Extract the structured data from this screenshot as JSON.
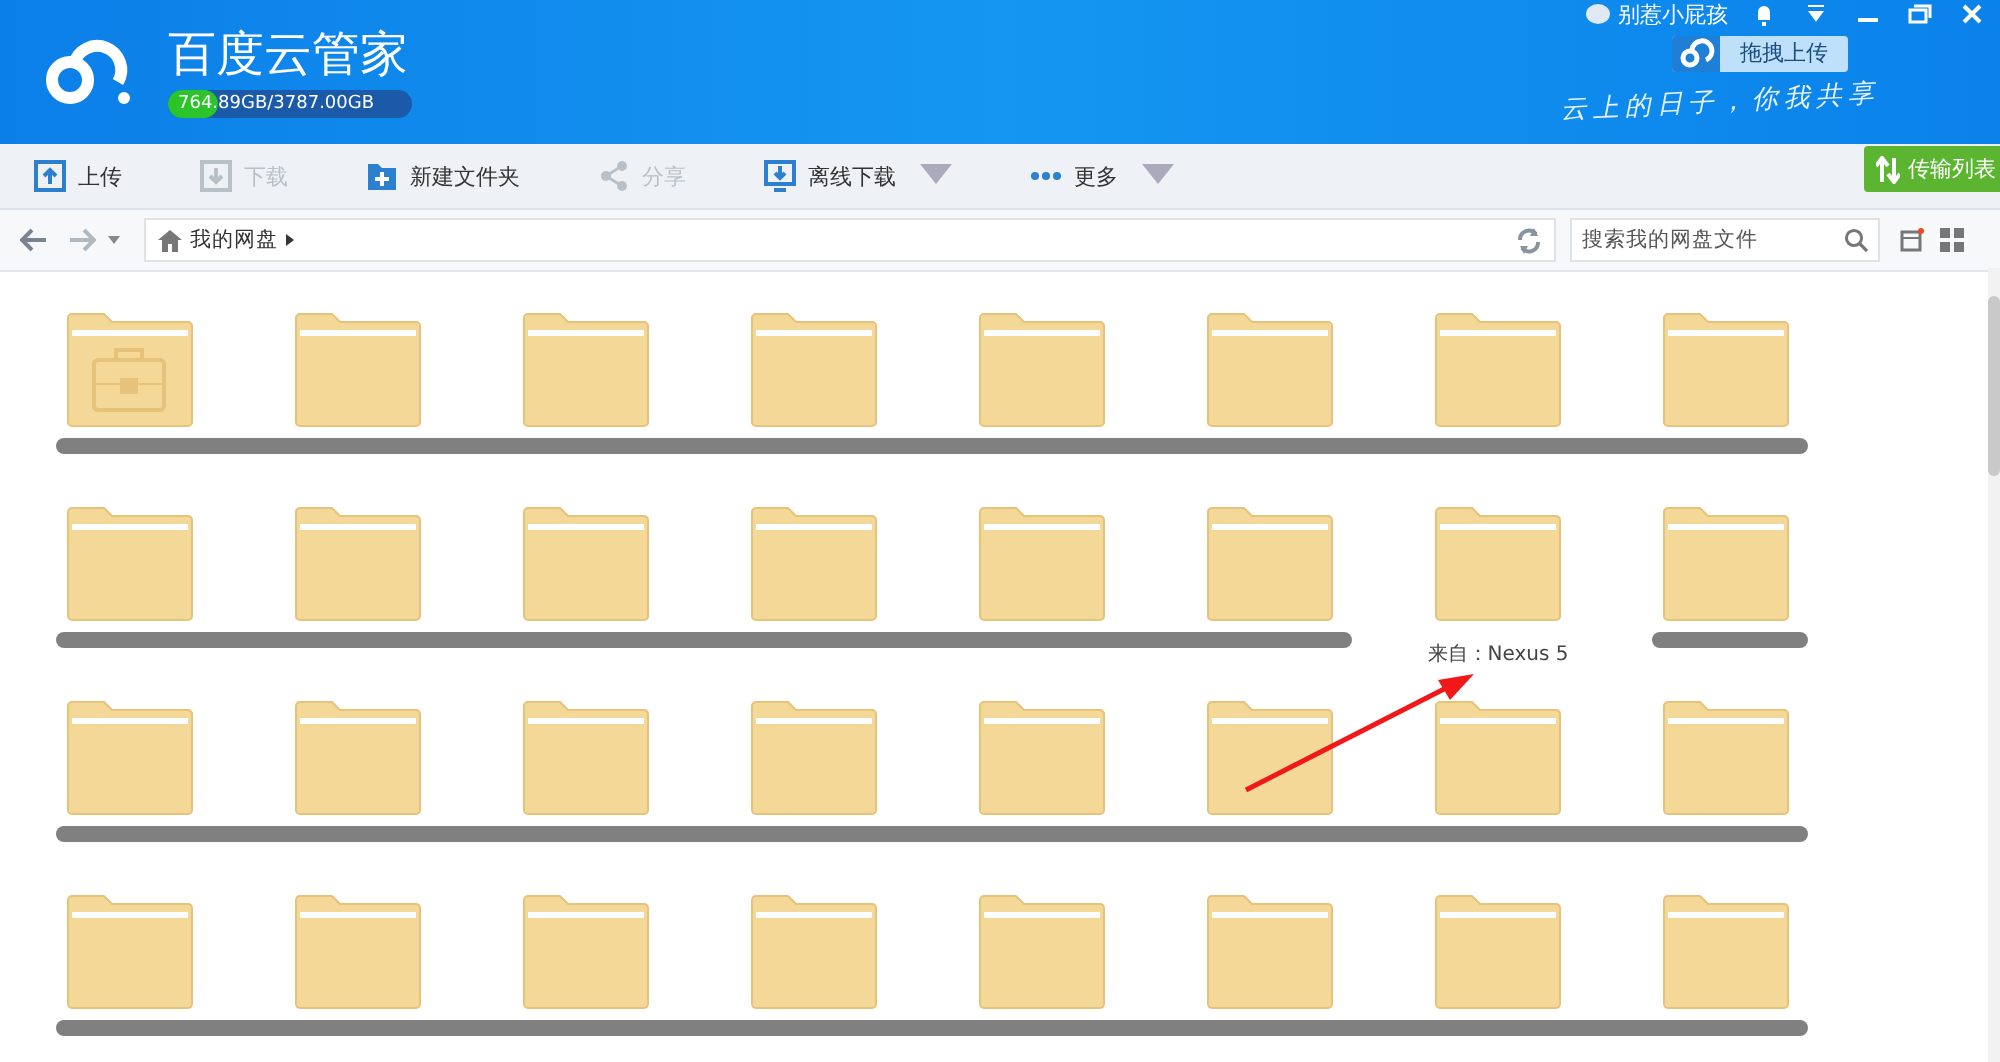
{
  "header": {
    "title": "百度云管家",
    "storage": {
      "text": "764.89GB/3787.00GB",
      "level": 0.202
    },
    "user": "别惹小屁孩",
    "drag_upload": "拖拽上传",
    "slogan": "云上的日子，你我共享"
  },
  "toolbar": [
    {
      "kind": "upload",
      "label": "上传",
      "disabled": false,
      "dropdown": false
    },
    {
      "kind": "download",
      "label": "下载",
      "disabled": true,
      "dropdown": false
    },
    {
      "kind": "newfolder",
      "label": "新建文件夹",
      "disabled": false,
      "dropdown": false
    },
    {
      "kind": "share",
      "label": "分享",
      "disabled": true,
      "dropdown": false
    },
    {
      "kind": "offline",
      "label": "离线下载",
      "disabled": false,
      "dropdown": true
    },
    {
      "kind": "more",
      "label": "更多",
      "disabled": false,
      "dropdown": true
    }
  ],
  "transfer_button": "传输列表",
  "breadcrumb": [
    "我的网盘"
  ],
  "search": {
    "placeholder": "搜索我的网盘文件"
  },
  "rows": [
    {
      "folders": [
        {
          "kind": "safe",
          "redacted": true
        },
        {
          "kind": "folder",
          "redacted": true
        },
        {
          "kind": "folder",
          "redacted": true
        },
        {
          "kind": "folder",
          "redacted": true
        },
        {
          "kind": "folder",
          "redacted": true
        },
        {
          "kind": "folder",
          "redacted": true
        },
        {
          "kind": "folder",
          "redacted": true
        },
        {
          "kind": "folder",
          "redacted": true
        }
      ]
    },
    {
      "folders": [
        {
          "kind": "folder",
          "redacted": true
        },
        {
          "kind": "folder",
          "redacted": true
        },
        {
          "kind": "folder",
          "redacted": true
        },
        {
          "kind": "folder",
          "redacted": true
        },
        {
          "kind": "folder",
          "redacted": true
        },
        {
          "kind": "folder",
          "redacted": true
        },
        {
          "kind": "folder",
          "redacted": false,
          "label": "来自：Nexus 5"
        },
        {
          "kind": "folder",
          "redacted": true
        }
      ]
    },
    {
      "folders": [
        {
          "kind": "folder",
          "redacted": true
        },
        {
          "kind": "folder",
          "redacted": true
        },
        {
          "kind": "folder",
          "redacted": true
        },
        {
          "kind": "folder",
          "redacted": true
        },
        {
          "kind": "folder",
          "redacted": true
        },
        {
          "kind": "folder",
          "redacted": true
        },
        {
          "kind": "folder",
          "redacted": true
        },
        {
          "kind": "folder",
          "redacted": true
        }
      ]
    },
    {
      "folders": [
        {
          "kind": "folder",
          "redacted": true
        },
        {
          "kind": "folder",
          "redacted": true
        },
        {
          "kind": "folder",
          "redacted": true
        },
        {
          "kind": "folder",
          "redacted": true
        },
        {
          "kind": "folder",
          "redacted": true
        },
        {
          "kind": "folder",
          "redacted": true
        },
        {
          "kind": "folder",
          "redacted": true
        },
        {
          "kind": "folder",
          "redacted": true
        }
      ]
    }
  ]
}
